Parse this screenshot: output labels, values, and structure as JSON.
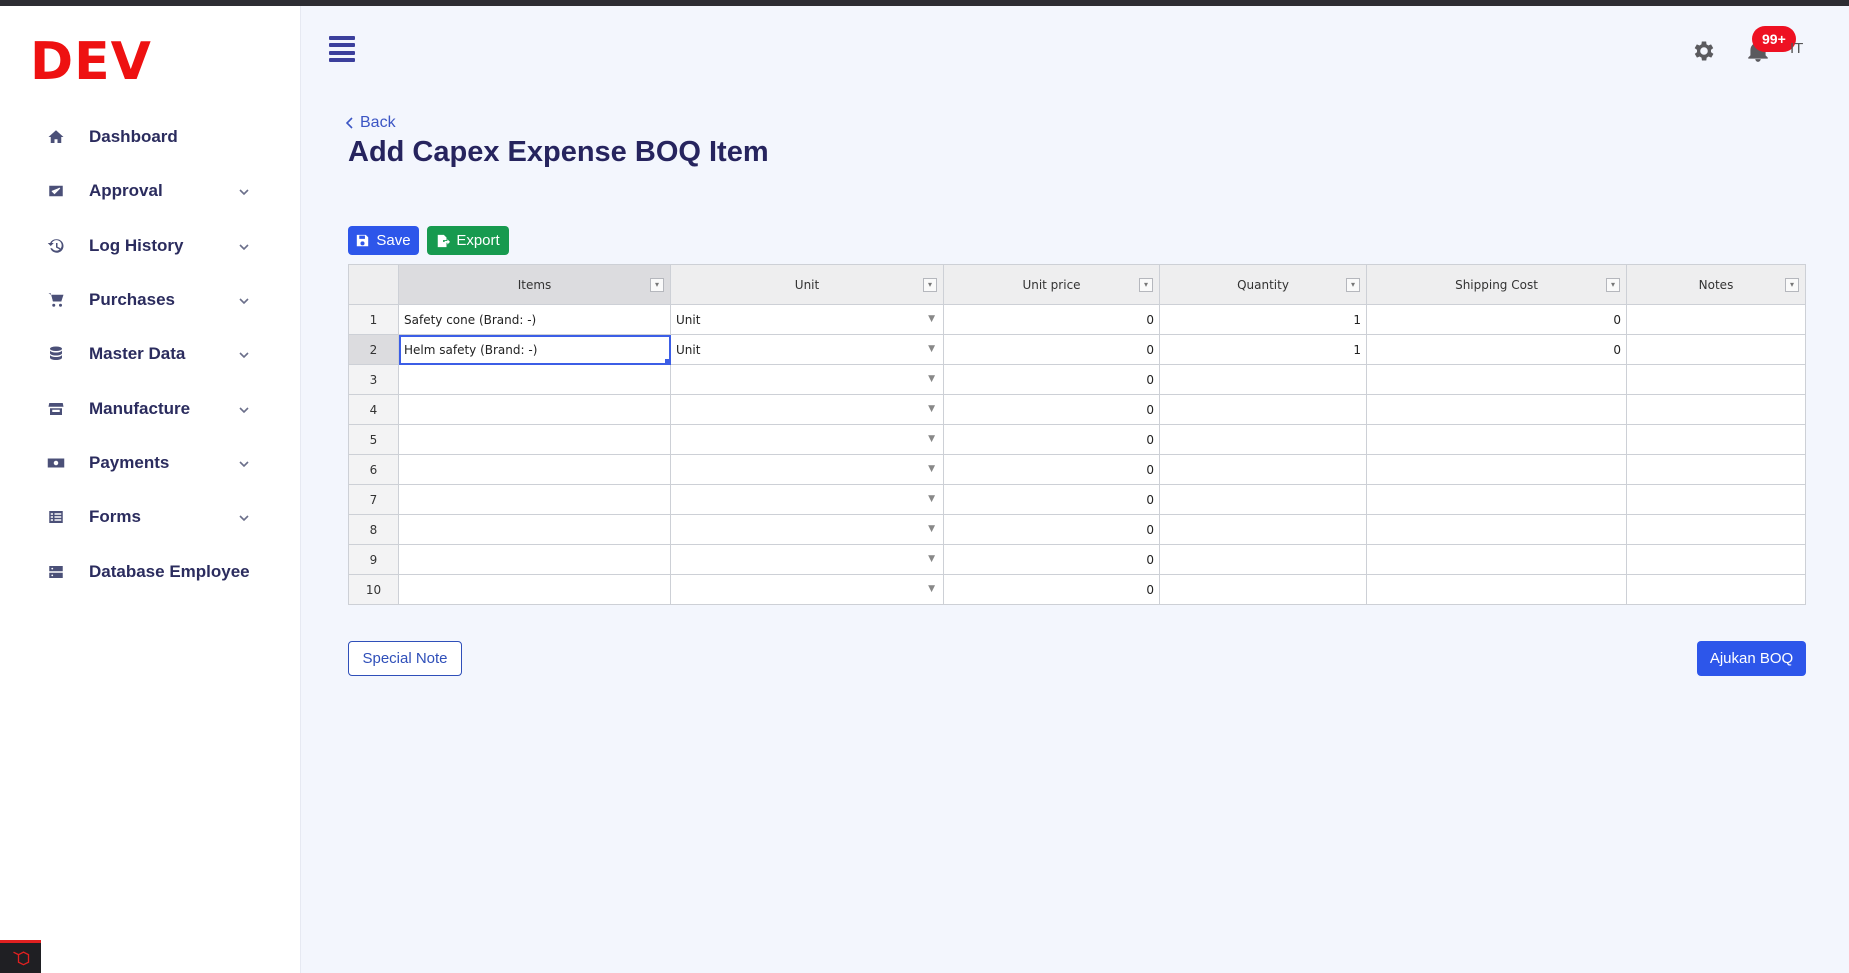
{
  "brand": {
    "logo_text": "DEV"
  },
  "sidebar": {
    "items": [
      {
        "label": "Dashboard",
        "icon": "home-icon",
        "has_dropdown": false
      },
      {
        "label": "Approval",
        "icon": "approval-icon",
        "has_dropdown": true
      },
      {
        "label": "Log History",
        "icon": "history-icon",
        "has_dropdown": true
      },
      {
        "label": "Purchases",
        "icon": "cart-icon",
        "has_dropdown": true
      },
      {
        "label": "Master Data",
        "icon": "database-icon",
        "has_dropdown": true
      },
      {
        "label": "Manufacture",
        "icon": "store-icon",
        "has_dropdown": true
      },
      {
        "label": "Payments",
        "icon": "money-icon",
        "has_dropdown": true
      },
      {
        "label": "Forms",
        "icon": "list-icon",
        "has_dropdown": true
      },
      {
        "label": "Database Employee",
        "icon": "server-icon",
        "has_dropdown": false
      }
    ]
  },
  "header": {
    "notification_badge": "99+",
    "user_initial": "IT"
  },
  "page": {
    "back_label": "Back",
    "title": "Add Capex Expense BOQ Item"
  },
  "toolbar": {
    "save_label": "Save",
    "export_label": "Export"
  },
  "sheet": {
    "columns": [
      "Items",
      "Unit",
      "Unit price",
      "Quantity",
      "Shipping Cost",
      "Notes"
    ],
    "rows": [
      {
        "num": "1",
        "item": "Safety cone (Brand: -)",
        "unit": "Unit",
        "unit_price": "0",
        "quantity": "1",
        "shipping": "0",
        "notes": ""
      },
      {
        "num": "2",
        "item": "Helm safety (Brand: -)",
        "unit": "Unit",
        "unit_price": "0",
        "quantity": "1",
        "shipping": "0",
        "notes": ""
      },
      {
        "num": "3",
        "item": "",
        "unit": "",
        "unit_price": "0",
        "quantity": "",
        "shipping": "",
        "notes": ""
      },
      {
        "num": "4",
        "item": "",
        "unit": "",
        "unit_price": "0",
        "quantity": "",
        "shipping": "",
        "notes": ""
      },
      {
        "num": "5",
        "item": "",
        "unit": "",
        "unit_price": "0",
        "quantity": "",
        "shipping": "",
        "notes": ""
      },
      {
        "num": "6",
        "item": "",
        "unit": "",
        "unit_price": "0",
        "quantity": "",
        "shipping": "",
        "notes": ""
      },
      {
        "num": "7",
        "item": "",
        "unit": "",
        "unit_price": "0",
        "quantity": "",
        "shipping": "",
        "notes": ""
      },
      {
        "num": "8",
        "item": "",
        "unit": "",
        "unit_price": "0",
        "quantity": "",
        "shipping": "",
        "notes": ""
      },
      {
        "num": "9",
        "item": "",
        "unit": "",
        "unit_price": "0",
        "quantity": "",
        "shipping": "",
        "notes": ""
      },
      {
        "num": "10",
        "item": "",
        "unit": "",
        "unit_price": "0",
        "quantity": "",
        "shipping": "",
        "notes": ""
      }
    ]
  },
  "footer": {
    "special_note_label": "Special Note",
    "submit_label": "Ajukan BOQ"
  }
}
